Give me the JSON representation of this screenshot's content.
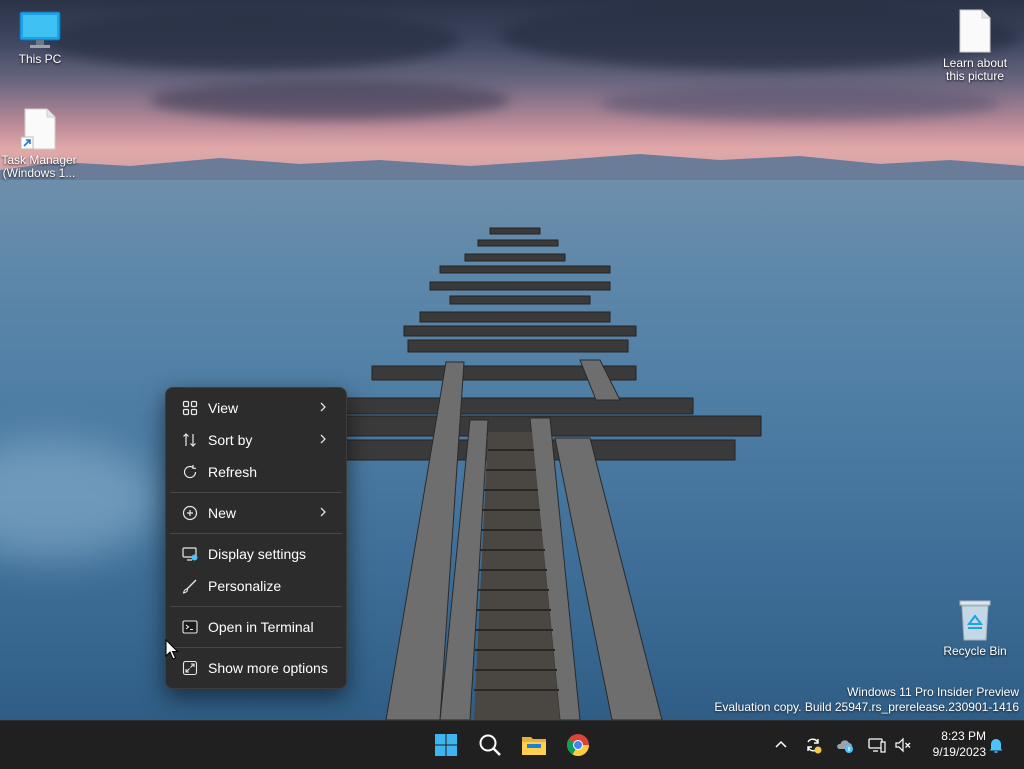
{
  "desktop": {
    "icons": [
      {
        "label": "This PC",
        "icon": "this-pc-icon"
      },
      {
        "label": "Task Manager (Windows 1...",
        "icon": "shortcut-file-icon"
      },
      {
        "label": "Learn about this picture",
        "icon": "file-icon"
      },
      {
        "label": "Recycle Bin",
        "icon": "recycle-bin-icon"
      }
    ]
  },
  "context_menu": {
    "items": [
      {
        "label": "View",
        "icon": "grid-icon",
        "submenu": true
      },
      {
        "label": "Sort by",
        "icon": "sort-icon",
        "submenu": true
      },
      {
        "label": "Refresh",
        "icon": "refresh-icon",
        "submenu": false
      },
      {
        "label": "New",
        "icon": "plus-circle-icon",
        "submenu": true
      },
      {
        "label": "Display settings",
        "icon": "display-icon",
        "submenu": false
      },
      {
        "label": "Personalize",
        "icon": "brush-icon",
        "submenu": false
      },
      {
        "label": "Open in Terminal",
        "icon": "terminal-icon",
        "submenu": false
      },
      {
        "label": "Show more options",
        "icon": "expand-icon",
        "submenu": false
      }
    ]
  },
  "watermark": {
    "line1": "Windows 11 Pro Insider Preview",
    "line2": "Evaluation copy. Build 25947.rs_prerelease.230901-1416"
  },
  "taskbar": {
    "apps": [
      "start-icon",
      "search-icon",
      "file-explorer-icon",
      "chrome-icon"
    ],
    "tray": [
      "chevron-up-icon",
      "sync-icon",
      "onedrive-icon",
      "network-icon",
      "volume-muted-icon",
      "notification-bell-icon"
    ],
    "time": "8:23 PM",
    "date": "9/19/2023"
  },
  "colors": {
    "menu_bg": "#2c2c2c",
    "taskbar_bg": "#202020",
    "accent": "#4cc2ff"
  }
}
